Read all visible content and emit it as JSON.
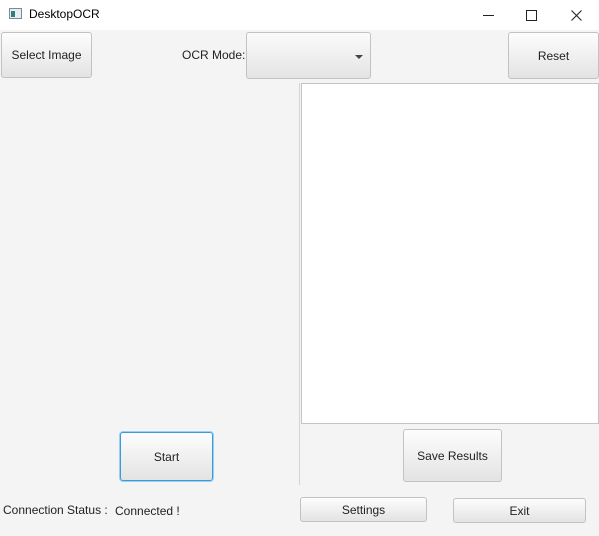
{
  "window": {
    "title": "DesktopOCR",
    "icon": "app-icon",
    "controls": [
      "minimize-icon",
      "maximize-icon",
      "close-icon"
    ]
  },
  "toolbar": {
    "select_image_label": "Select Image",
    "ocr_mode_label": "OCR Mode:",
    "ocr_mode_value": "",
    "reset_label": "Reset"
  },
  "left_panel": {
    "start_label": "Start"
  },
  "right_panel": {
    "results_text": "",
    "save_results_label": "Save Results"
  },
  "footer": {
    "connection_status_label": "Connection Status :",
    "connection_status_value": "Connected !",
    "settings_label": "Settings",
    "exit_label": "Exit"
  }
}
